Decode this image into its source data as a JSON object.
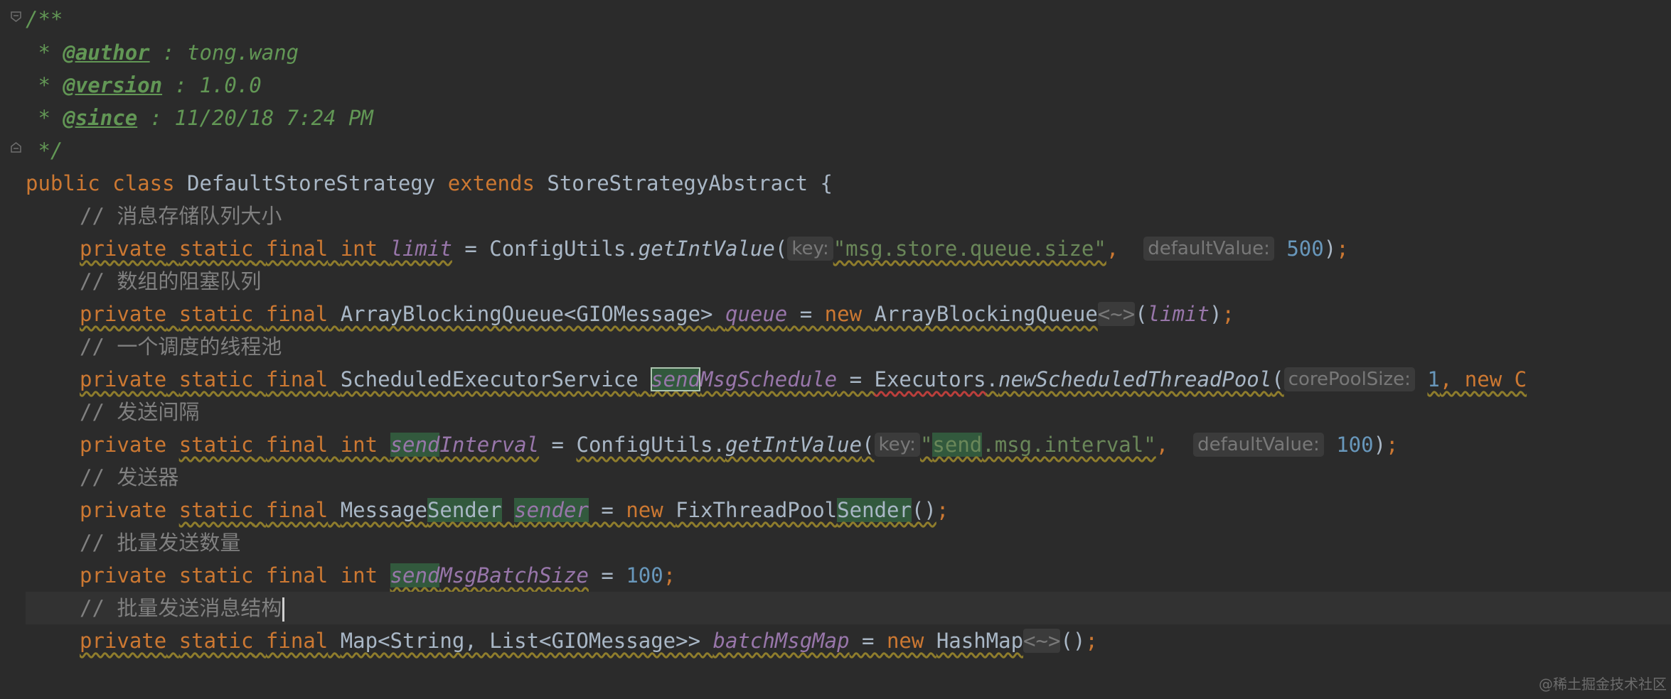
{
  "editor": {
    "javadoc": {
      "open": "/**",
      "author_tag": "@author",
      "author_value": " : tong.wang",
      "version_tag": "@version",
      "version_value": " : 1.0.0",
      "since_tag": "@since",
      "since_value": " : 11/20/18 7:24 PM",
      "close": " */",
      "star": " * "
    },
    "class_decl": {
      "kw_public": "public",
      "kw_class": "class",
      "class_name": "DefaultStoreStrategy",
      "kw_extends": "extends",
      "parent": "StoreStrategyAbstract",
      "brace": "{"
    },
    "tokens": {
      "private": "private",
      "static": "static",
      "final": "final",
      "int": "int",
      "new": "new",
      "eq": " = ",
      "semi": ";",
      "diamond": "<~>"
    },
    "fields": [
      {
        "comment": "// 消息存储队列大小",
        "name": "limit",
        "init_class": "ConfigUtils",
        "init_method": "getIntValue",
        "hint_key": "key:",
        "string_value": "\"msg.store.queue.size\"",
        "hint_default": "defaultValue:",
        "default_value": "500"
      },
      {
        "comment": "// 数组的阻塞队列",
        "type": "ArrayBlockingQueue<GIOMessage>",
        "name": "queue",
        "init_class": "ArrayBlockingQueue",
        "arg": "limit"
      },
      {
        "comment": "// 一个调度的线程池",
        "type": "ScheduledExecutorService",
        "name_hl": "send",
        "name_rest": "MsgSchedule",
        "init_class": "Executors",
        "init_method": "newScheduledThreadPool",
        "hint_core": "corePoolSize:",
        "core_value": "1",
        "trailing": ", new C"
      },
      {
        "comment": "// 发送间隔",
        "name_hl": "send",
        "name_rest": "Interval",
        "init_class": "ConfigUtils",
        "init_method": "getIntValue",
        "hint_key": "key:",
        "string_hl": "send",
        "string_rest": ".msg.interval\"",
        "hint_default": "defaultValue:",
        "default_value": "100"
      },
      {
        "comment": "// 发送器",
        "type_a": "Message",
        "type_hl": "Sender",
        "name": "sender",
        "init_a": "FixThreadPool",
        "init_hl": "Sender"
      },
      {
        "comment": "// 批量发送数量",
        "name_hl": "send",
        "name_rest": "MsgBatchSize",
        "value": "100"
      },
      {
        "comment": "// 批量发送消息结构",
        "type": "Map<String, List<GIOMessage>>",
        "name": "batchMsgMap",
        "init_class": "HashMap"
      }
    ]
  },
  "watermark": "@稀土掘金技术社区"
}
